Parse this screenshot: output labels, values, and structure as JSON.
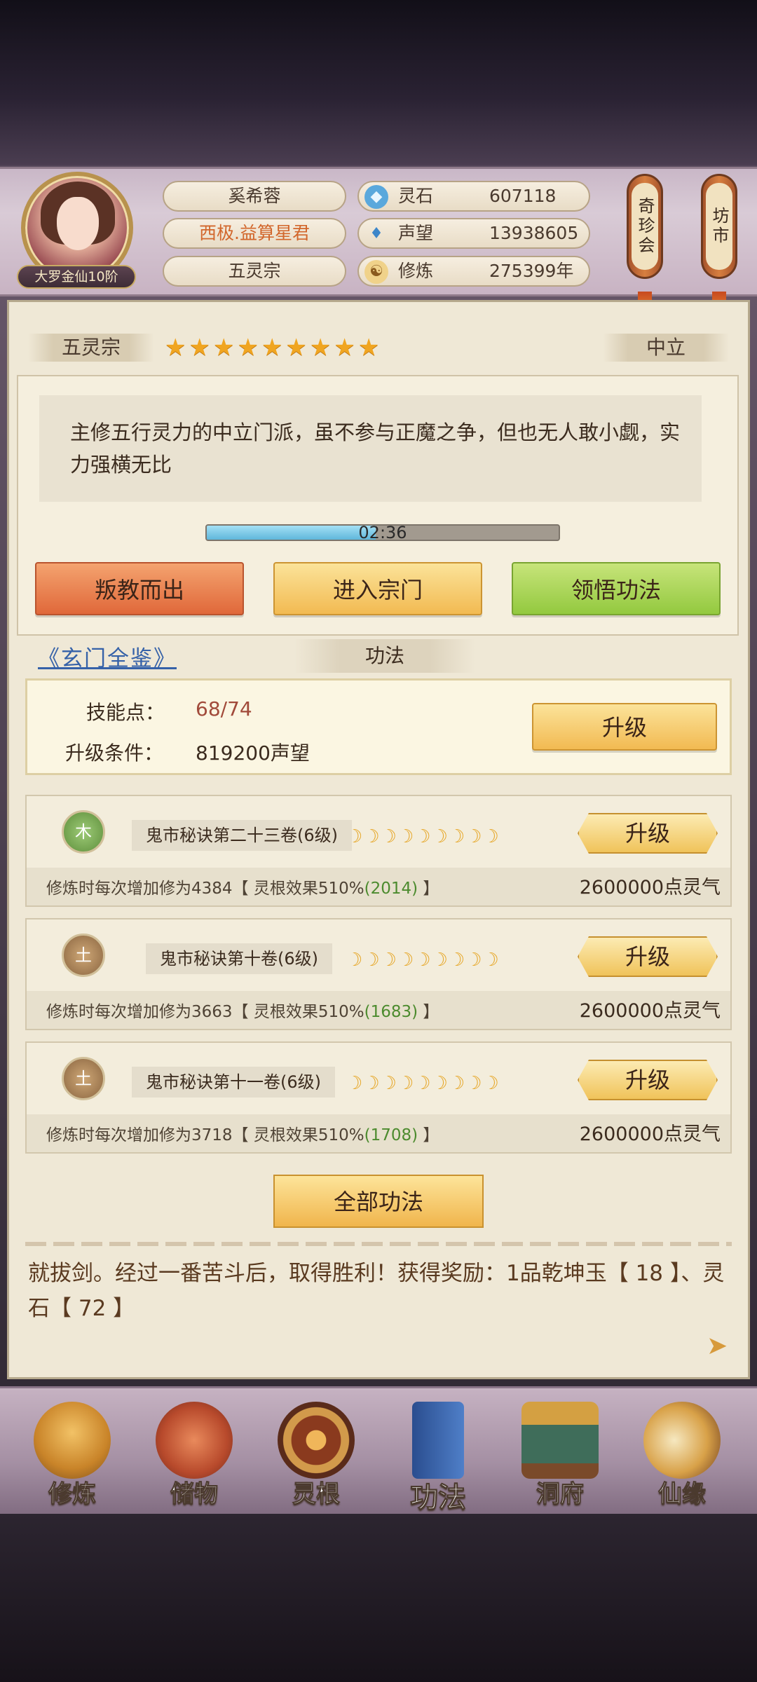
{
  "player": {
    "name": "奚希蓉",
    "title": "西极.益算星君",
    "sect": "五灵宗",
    "rank": "大罗金仙10阶"
  },
  "resources": [
    {
      "icon": "spirit-stone-icon",
      "label": "灵石",
      "value": "607118"
    },
    {
      "icon": "reputation-icon",
      "label": "声望",
      "value": "13938605"
    },
    {
      "icon": "meditation-icon",
      "label": "修炼",
      "value": "275399年"
    }
  ],
  "side_buttons": {
    "treasure_pavilion": "奇珍会",
    "market": "坊市"
  },
  "sect_panel": {
    "name": "五灵宗",
    "stars": 9,
    "alignment": "中立",
    "description": "主修五行灵力的中立门派，虽不参与正魔之争，但也无人敢小觑，实力强横无比",
    "timer": "02:36",
    "timer_progress": 0.48,
    "buttons": {
      "betray": "叛教而出",
      "enter": "进入宗门",
      "comprehend": "领悟功法"
    }
  },
  "link_title": "《玄门全鉴》",
  "section_tab": "功法",
  "skill_points": {
    "points_label": "技能点：",
    "points_value": "68/74",
    "condition_label": "升级条件：",
    "condition_value": "819200声望",
    "upgrade_label": "升级"
  },
  "techniques": [
    {
      "element": "木",
      "element_type": "wood",
      "name": "鬼市秘诀第二十三卷(6级)",
      "moons": 9,
      "upgrade": "升级",
      "desc_prefix": "修炼时每次增加修为4384【 灵根效果510%",
      "desc_bonus": "(2014)",
      "desc_suffix": " 】",
      "cost": "2600000点灵气"
    },
    {
      "element": "土",
      "element_type": "earth",
      "name": "鬼市秘诀第十卷(6级)",
      "moons": 9,
      "upgrade": "升级",
      "desc_prefix": "修炼时每次增加修为3663【 灵根效果510%",
      "desc_bonus": "(1683)",
      "desc_suffix": " 】",
      "cost": "2600000点灵气"
    },
    {
      "element": "土",
      "element_type": "earth",
      "name": "鬼市秘诀第十一卷(6级)",
      "moons": 9,
      "upgrade": "升级",
      "desc_prefix": "修炼时每次增加修为3718【 灵根效果510%",
      "desc_bonus": "(1708)",
      "desc_suffix": " 】",
      "cost": "2600000点灵气"
    }
  ],
  "all_techniques": "全部功法",
  "log": "就拔剑。经过一番苦斗后，取得胜利！获得奖励：1品乾坤玉【 18 】、灵石【 72 】",
  "nav": [
    {
      "label": "修炼",
      "icon": "cultivate-icon",
      "active": false
    },
    {
      "label": "储物",
      "icon": "storage-bag-icon",
      "active": false
    },
    {
      "label": "灵根",
      "icon": "spirit-root-icon",
      "active": false
    },
    {
      "label": "功法",
      "icon": "technique-book-icon",
      "active": true
    },
    {
      "label": "洞府",
      "icon": "cave-dwelling-icon",
      "active": false
    },
    {
      "label": "仙缘",
      "icon": "immortal-fate-icon",
      "active": false
    }
  ],
  "colors": {
    "accent_gold": "#f2ba52",
    "accent_red": "#e0683a",
    "accent_green": "#93c93f",
    "timer_blue": "#5fb7db",
    "bonus_green": "#4c8b2e"
  }
}
